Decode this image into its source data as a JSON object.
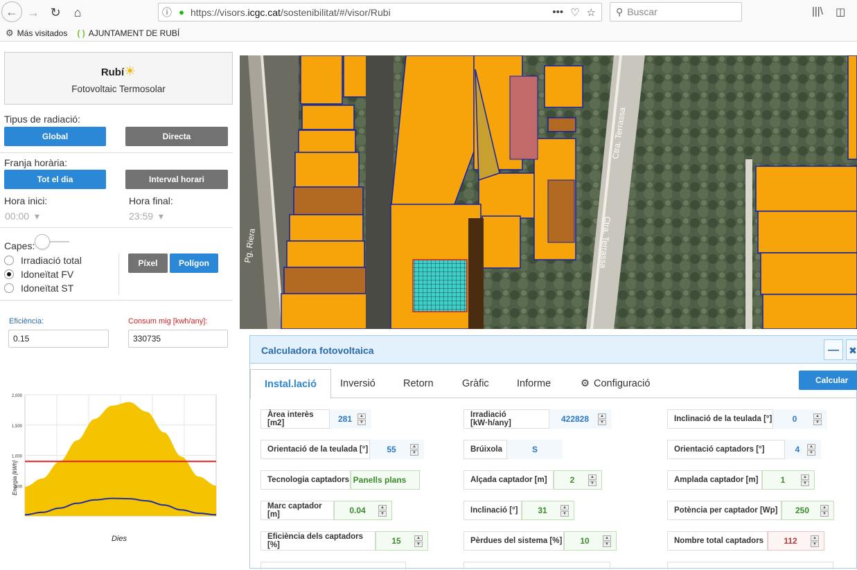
{
  "browser": {
    "url_prefix": "https://visors.",
    "url_domain": "icgc.cat",
    "url_suffix": "/sostenibilitat/#/visor/Rubi",
    "search_placeholder": "Buscar",
    "bookmarks": [
      {
        "label": "Más visitados"
      },
      {
        "label": "AJUNTAMENT DE RUBÍ"
      }
    ]
  },
  "panel": {
    "title": "Rubí",
    "subtitle": "Fotovoltaic Termosolar",
    "radiation_label": "Tipus de radiació:",
    "global_btn": "Global",
    "directa_btn": "Directa",
    "franja_label": "Franja horària:",
    "totdia_btn": "Tot el dia",
    "interval_btn": "Interval horari",
    "hora_inici_label": "Hora inici:",
    "hora_final_label": "Hora final:",
    "hora_inici": "00:00",
    "hora_final": "23:59",
    "capes_label": "Capes:",
    "layers": [
      "Irradiació total",
      "Idoneïtat FV",
      "Idoneïtat ST"
    ],
    "selected_layer": 1,
    "pixel_btn": "Píxel",
    "poligon_btn": "Polígon",
    "eficiencia_label": "Eficiència:",
    "eficiencia": "0.15",
    "consum_label": "Consum mig [kwh/any]:",
    "consum": "330735",
    "label_color_blue": "#2a6aa8",
    "label_color_red": "#d02020"
  },
  "chart_data": {
    "type": "area",
    "ylabel": "Energia [kWh]",
    "xlabel": "Dies",
    "ylim": [
      0,
      2000
    ],
    "yticks": [
      "2,000",
      "1,500",
      "1,000",
      "500"
    ],
    "grid": true,
    "series": [
      {
        "values": [
          480,
          620,
          900,
          1250,
          1600,
          1820,
          1880,
          1720,
          1380,
          980,
          650,
          500
        ],
        "color": "#f5c400"
      },
      {
        "values": [
          20,
          60,
          130,
          210,
          265,
          290,
          285,
          250,
          180,
          100,
          45,
          20
        ],
        "color": "#1c2ca8"
      },
      {
        "values": [
          900,
          900,
          900,
          900,
          900,
          900,
          900,
          900,
          900,
          900,
          900,
          900
        ],
        "color": "#e02020"
      }
    ]
  },
  "map": {
    "street_1": "Pg. Riera",
    "street_2": "Ctra. Terrassa",
    "street_3": "Ctra. Terrassa"
  },
  "calc": {
    "title": "Calculadora fotovoltaica",
    "minimize_icon": "minus-icon",
    "close_icon": "close-icon",
    "tabs": [
      "Instal.lació",
      "Inversió",
      "Retorn",
      "Gràfic",
      "Informe",
      "Configuració"
    ],
    "active_tab": 0,
    "calcular_btn": "Calcular",
    "fields": [
      {
        "label": "Àrea interès [m2]",
        "value": "281",
        "style": "blue"
      },
      {
        "label": "Irradiació [kW·h/any]",
        "value": "422828",
        "style": "blue"
      },
      {
        "label": "Inclinació de la teulada [°]",
        "value": "0",
        "style": "blue"
      },
      {
        "label": "Orientació de la teulada [°]",
        "value": "55",
        "style": "blue"
      },
      {
        "label": "Brúixola",
        "value": "S",
        "style": "blue"
      },
      {
        "label": "Orientació captadors [°]",
        "value": "4",
        "style": "blue"
      },
      {
        "label": "Tecnologia captadors",
        "value": "Panells plans",
        "style": "green"
      },
      {
        "label": "Alçada captador [m]",
        "value": "2",
        "style": "green"
      },
      {
        "label": "Amplada captador [m]",
        "value": "1",
        "style": "green"
      },
      {
        "label": "Marc captador [m]",
        "value": "0.04",
        "style": "green"
      },
      {
        "label": "Inclinació [°]",
        "value": "31",
        "style": "green"
      },
      {
        "label": "Potència per captador [Wp]",
        "value": "250",
        "style": "green"
      },
      {
        "label": "Eficiència dels captadors [%]",
        "value": "15",
        "style": "green"
      },
      {
        "label": "Pèrdues del sistema [%]",
        "value": "10",
        "style": "green"
      },
      {
        "label": "Nombre total captadors",
        "value": "112",
        "style": "red"
      }
    ]
  }
}
